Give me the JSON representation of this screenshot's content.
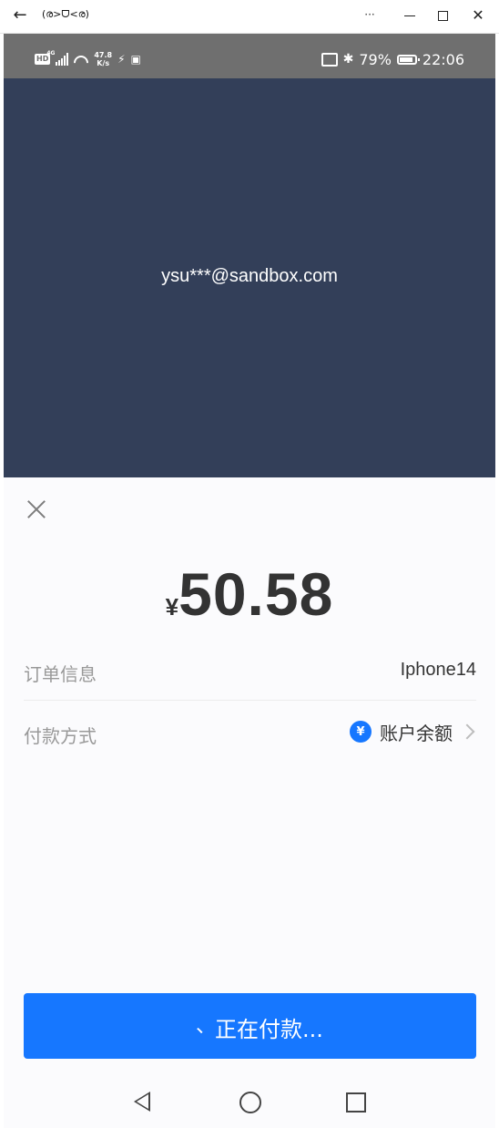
{
  "window": {
    "title": "(ര>ᗜ<ര)",
    "more_label": "···",
    "close_label": "✕",
    "back_label": "←"
  },
  "status_bar": {
    "hd": "HD",
    "network": "4G",
    "speed_value": "47.8",
    "speed_unit": "K/s",
    "battery": "79%",
    "time": "22:06"
  },
  "account": {
    "email": "ysu***@sandbox.com",
    "banner_color": "#333f59"
  },
  "payment": {
    "currency_symbol": "¥",
    "amount": "50.58",
    "order_info_label": "订单信息",
    "order_info_value": "Iphone14",
    "method_label": "付款方式",
    "method_icon_glyph": "¥",
    "method_value": "账户余额",
    "pay_button_spinner": "、",
    "pay_button_label": "正在付款...",
    "accent_color": "#1677ff"
  },
  "navigation": {
    "items": [
      "back-icon",
      "home-icon",
      "recent-apps-icon"
    ]
  }
}
